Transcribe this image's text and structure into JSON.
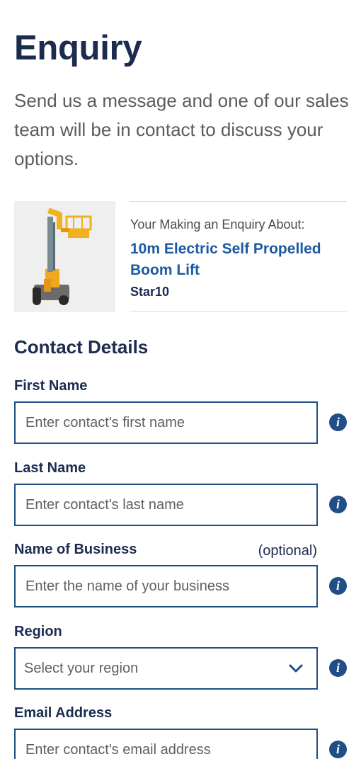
{
  "page": {
    "title": "Enquiry",
    "intro": "Send us a message and one of our sales team will be in contact to discuss your options."
  },
  "product": {
    "pre_label": "Your Making an Enquiry About:",
    "name": "10m Electric Self Propelled Boom Lift",
    "model": "Star10",
    "image_icon": "boom-lift-image"
  },
  "contact": {
    "section_title": "Contact Details",
    "first_name": {
      "label": "First Name",
      "placeholder": "Enter contact's first name"
    },
    "last_name": {
      "label": "Last Name",
      "placeholder": "Enter contact's last name"
    },
    "business": {
      "label": "Name of Business",
      "optional": "(optional)",
      "placeholder": "Enter the name of your business"
    },
    "region": {
      "label": "Region",
      "selected": "Select your region"
    },
    "email": {
      "label": "Email Address",
      "placeholder": "Enter contact's email address"
    },
    "info_glyph": "i"
  },
  "colors": {
    "heading": "#1c2b4f",
    "accent": "#1f4f86",
    "link": "#1a5aa0",
    "body_text": "#5c5c5c"
  }
}
